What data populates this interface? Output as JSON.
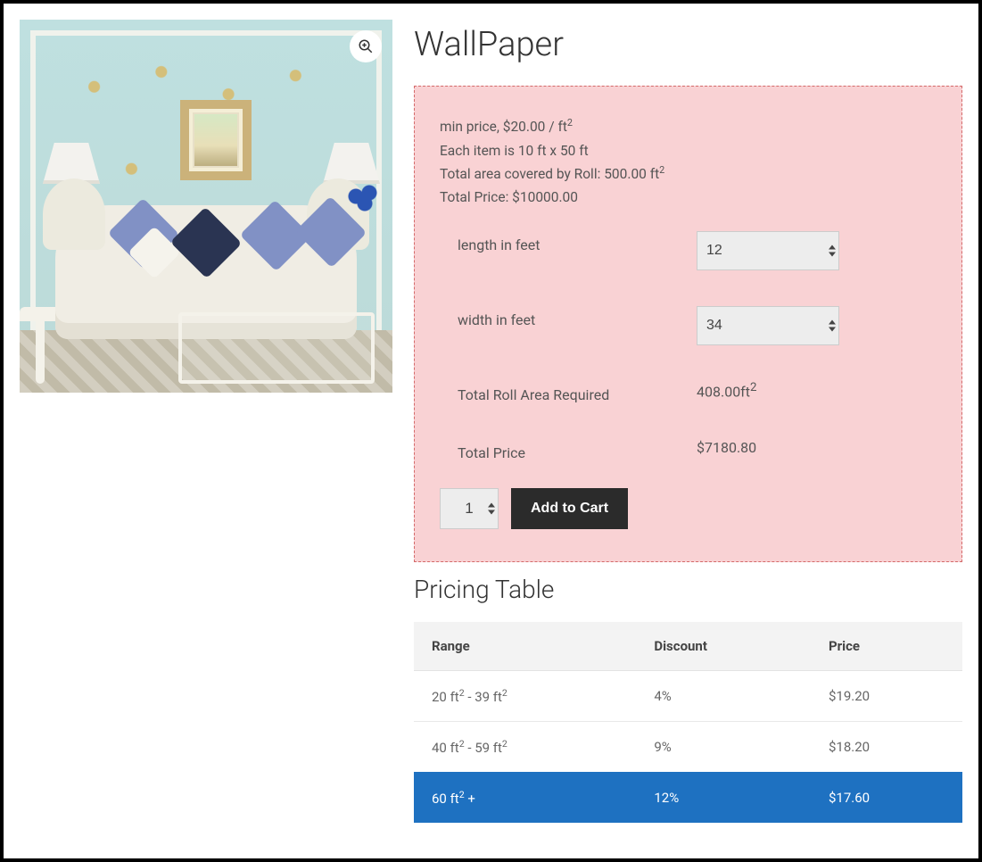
{
  "product": {
    "title": "WallPaper",
    "zoom_icon": "magnify-plus-icon",
    "info": {
      "min_price_label": "min price,",
      "min_price_value": "$20.00 / ft",
      "min_price_super": "2",
      "item_dims": "Each item is 10 ft x 50 ft",
      "total_area_label": "Total area covered by Roll:",
      "total_area_value": "500.00 ft",
      "total_area_super": "2",
      "total_price_line": "Total Price: $10000.00"
    },
    "measurements": {
      "length_label": "length in feet",
      "length_value": "12",
      "width_label": "width in feet",
      "width_value": "34",
      "roll_area_label": "Total Roll Area Required",
      "roll_area_value": "408.00ft",
      "roll_area_super": "2",
      "total_price_label": "Total Price",
      "total_price_value": "$7180.80"
    },
    "cart": {
      "qty_value": "1",
      "add_label": "Add to Cart"
    }
  },
  "pricing": {
    "title": "Pricing Table",
    "headers": {
      "range": "Range",
      "discount": "Discount",
      "price": "Price"
    },
    "rows": [
      {
        "range_a": "20 ft",
        "range_b": " - 39 ft",
        "discount": "4%",
        "price": "$19.20",
        "highlight": false
      },
      {
        "range_a": "40 ft",
        "range_b": " - 59 ft",
        "discount": "9%",
        "price": "$18.20",
        "highlight": false
      },
      {
        "range_a": "60 ft",
        "range_b": " +",
        "discount": "12%",
        "price": "$17.60",
        "highlight": true
      }
    ]
  },
  "chart_data": {
    "type": "table",
    "title": "Pricing Table",
    "columns": [
      "Range",
      "Discount",
      "Price"
    ],
    "rows": [
      [
        "20 ft² - 39 ft²",
        "4%",
        "$19.20"
      ],
      [
        "40 ft² - 59 ft²",
        "9%",
        "$18.20"
      ],
      [
        "60 ft² +",
        "12%",
        "$17.60"
      ]
    ]
  }
}
